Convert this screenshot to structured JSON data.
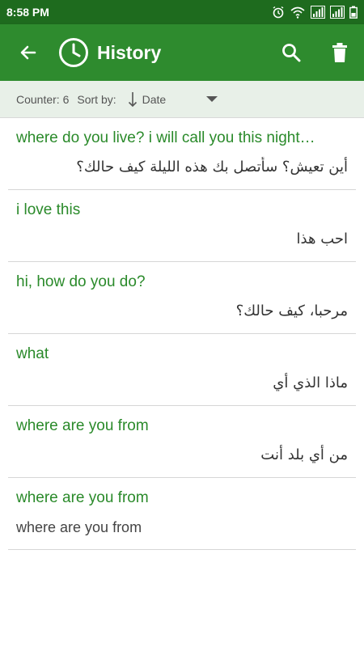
{
  "status": {
    "time": "8:58 PM"
  },
  "toolbar": {
    "title": "History"
  },
  "sort": {
    "counter": "Counter: 6",
    "label": "Sort by:",
    "value": "Date"
  },
  "colors": {
    "status_bar": "#1e6b1e",
    "app_bar": "#2e8b2e",
    "source_text": "#2a8a2a",
    "sort_bar": "#e8f0e8"
  },
  "icons": {
    "back": "arrow-left-icon",
    "history": "clock-icon",
    "search": "search-icon",
    "delete": "trash-icon",
    "sort": "arrow-down-icon",
    "dropdown": "caret-down-icon"
  },
  "history": [
    {
      "source": "where do you live?  i will call you this night…",
      "target": "أين تعيش؟ سأتصل بك هذه الليلة كيف حالك؟",
      "dir": "rtl"
    },
    {
      "source": "i love this",
      "target": "احب هذا",
      "dir": "rtl"
    },
    {
      "source": "hi, how do you do?",
      "target": "مرحبا، كيف حالك؟",
      "dir": "rtl"
    },
    {
      "source": "what",
      "target": "ماذا  الذي أي",
      "dir": "rtl"
    },
    {
      "source": "where are you from",
      "target": "من أي بلد أنت",
      "dir": "rtl"
    },
    {
      "source": "where are you from",
      "target": "where are you from",
      "dir": "ltr"
    }
  ]
}
